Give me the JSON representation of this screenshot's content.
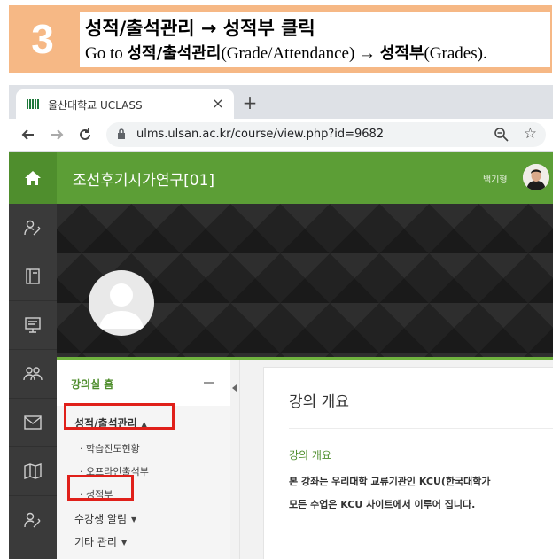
{
  "instruction": {
    "step_number": "3",
    "line1": "성적/출석관리 → 성적부 클릭",
    "line2_prefix": "Go to ",
    "line2_bold1": "성적/출석관리",
    "line2_mid": "(Grade/Attendance) → ",
    "line2_bold2": "성적부",
    "line2_suffix": "(Grades).",
    "banner_color": "#f6b885"
  },
  "browser": {
    "tab_title": "울산대학교 UCLASS",
    "tab_close": "×",
    "new_tab": "+",
    "url": "ulms.ulsan.ac.kr/course/view.php?id=9682",
    "icons": [
      "back-icon",
      "forward-icon",
      "reload-icon",
      "lock-icon",
      "zoom-icon",
      "star-icon"
    ]
  },
  "header": {
    "course_title": "조선후기시가연구[01]",
    "user_name": "백기형",
    "accent_color": "#5c9e36"
  },
  "rail": {
    "items": [
      "home-icon",
      "profile-icon",
      "book-icon",
      "board-icon",
      "group-icon",
      "mail-icon",
      "map-icon",
      "profile-icon"
    ]
  },
  "sidebar": {
    "home_label": "강의실 홈",
    "menu": [
      {
        "label": "성적/출석관리",
        "highlighted": true
      },
      {
        "label": "· 학습진도현황"
      },
      {
        "label": "· 오프라인출석부"
      },
      {
        "label": "· 성적부",
        "highlighted": true
      },
      {
        "label": "수강생 알림"
      },
      {
        "label": "기타 관리"
      }
    ]
  },
  "content": {
    "title": "강의 개요",
    "subtitle": "강의 개요",
    "paragraph_line1": "본 강좌는 우리대학 교류기관인 KCU(한국대학가",
    "paragraph_line2": "모든 수업은 KCU 사이트에서 이루어 집니다."
  }
}
